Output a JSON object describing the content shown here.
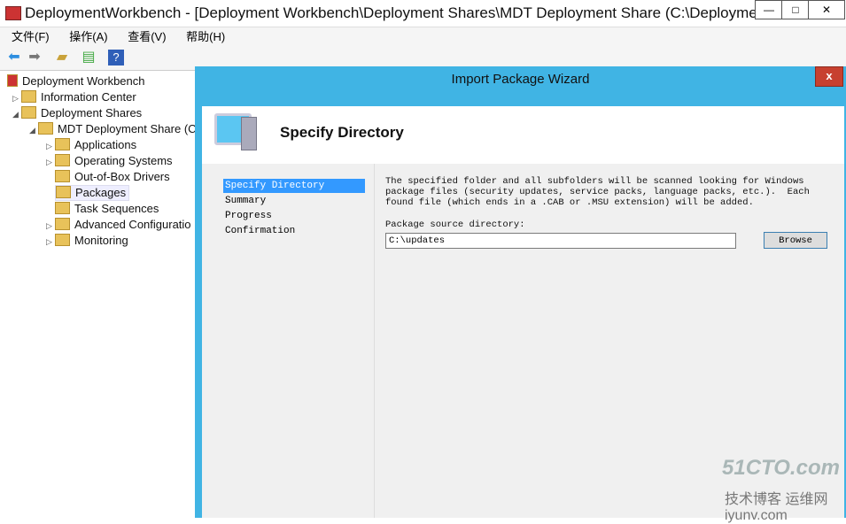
{
  "window": {
    "title": "DeploymentWorkbench - [Deployment Workbench\\Deployment Shares\\MDT Deployment Share (C:\\DeploymentS...",
    "minimize": "—",
    "maximize": "□",
    "close": "✕"
  },
  "menu": [
    "文件(F)",
    "操作(A)",
    "查看(V)",
    "帮助(H)"
  ],
  "tree": [
    {
      "label": "Deployment Workbench"
    },
    {
      "label": "Information Center"
    },
    {
      "label": "Deployment Shares"
    },
    {
      "label": "MDT Deployment Share (C"
    },
    {
      "label": "Applications"
    },
    {
      "label": "Operating Systems"
    },
    {
      "label": "Out-of-Box Drivers"
    },
    {
      "label": "Packages"
    },
    {
      "label": "Task Sequences"
    },
    {
      "label": "Advanced Configuratio"
    },
    {
      "label": "Monitoring"
    }
  ],
  "dialog": {
    "title": "Import Package Wizard",
    "close": "x",
    "header": "Specify Directory",
    "nav": [
      "Specify Directory",
      "Summary",
      "Progress",
      "Confirmation"
    ],
    "description": "The specified folder and all subfolders will be scanned looking for Windows\npackage files (security updates, service packs, language packs, etc.).  Each\nfound file (which ends in a .CAB or .MSU extension) will be added.",
    "source_label": "Package source directory:",
    "source_value": "C:\\updates",
    "browse": "Browse"
  },
  "watermark": {
    "main": "51CTO.com",
    "sub": "技术博客 运维网 iyunv.com"
  }
}
